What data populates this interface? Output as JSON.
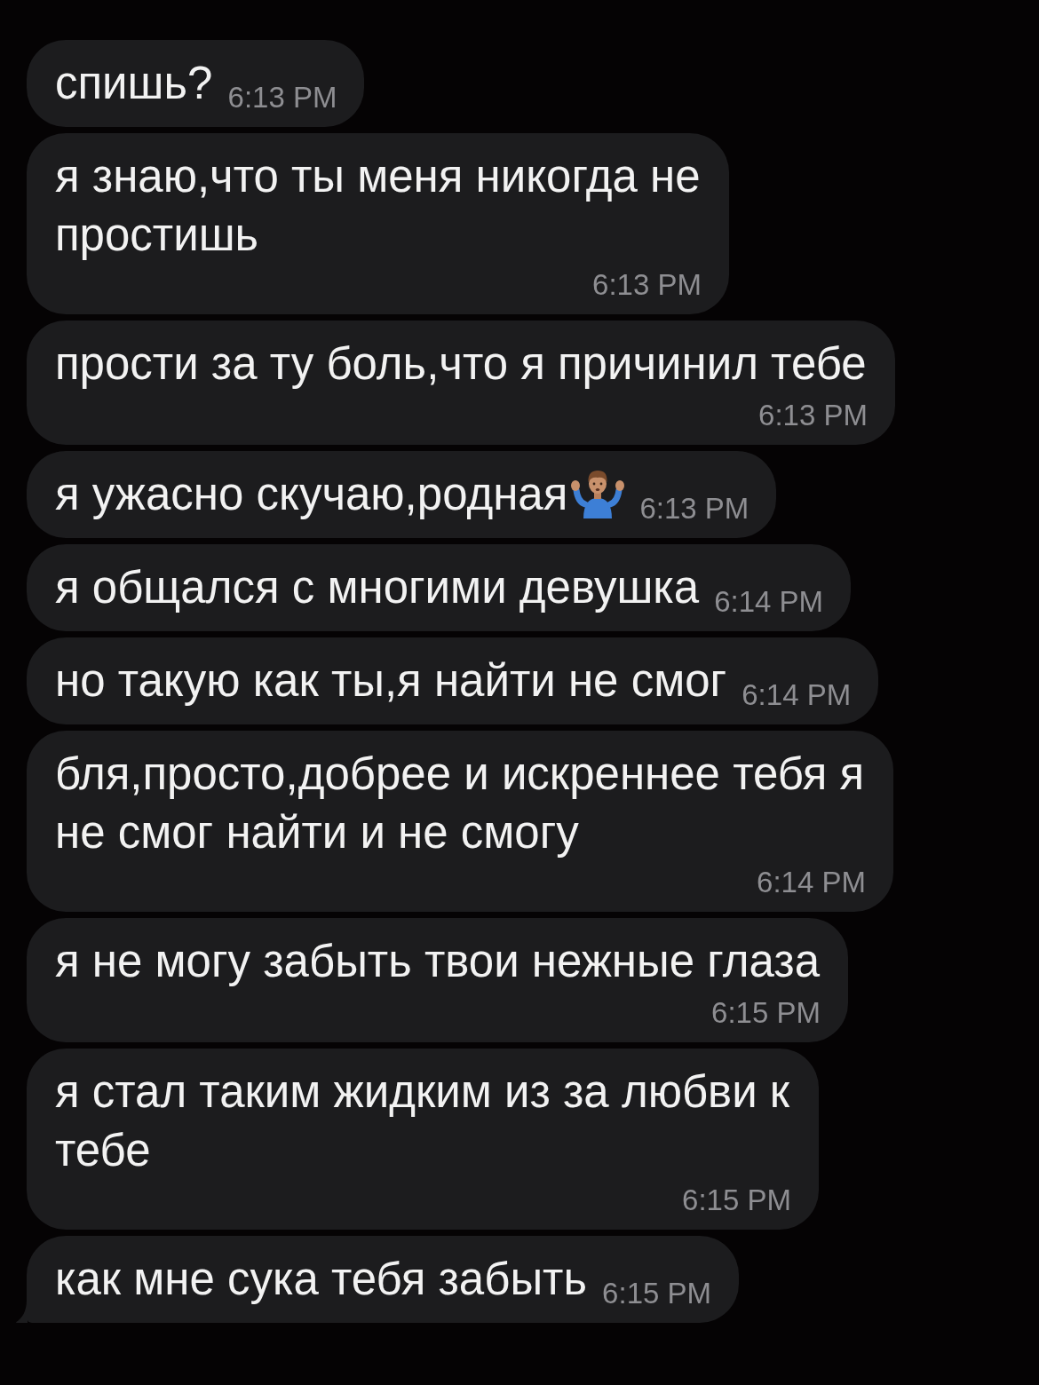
{
  "messages": [
    {
      "text": "спишь?",
      "time": "6:13 PM",
      "emoji": false,
      "tail": false
    },
    {
      "text": "я знаю,что ты меня никогда не простишь",
      "time": "6:13 PM",
      "emoji": false,
      "tail": false
    },
    {
      "text": "прости за ту боль,что я причинил тебе",
      "time": "6:13 PM",
      "emoji": false,
      "tail": false
    },
    {
      "text": "я ужасно скучаю,родная",
      "time": "6:13 PM",
      "emoji": true,
      "tail": false
    },
    {
      "text": "я общался с многими девушка",
      "time": "6:14 PM",
      "emoji": false,
      "tail": false
    },
    {
      "text": "но такую как ты,я найти не смог",
      "time": "6:14 PM",
      "emoji": false,
      "tail": false
    },
    {
      "text": "бля,просто,добрее и искреннее тебя я не смог найти и не смогу",
      "time": "6:14 PM",
      "emoji": false,
      "tail": false
    },
    {
      "text": "я не могу забыть твои нежные глаза",
      "time": "6:15 PM",
      "emoji": false,
      "tail": false
    },
    {
      "text": "я стал таким жидким из за любви к тебе",
      "time": "6:15 PM",
      "emoji": false,
      "tail": false
    },
    {
      "text": "как мне сука тебя забыть",
      "time": "6:15 PM",
      "emoji": false,
      "tail": true
    }
  ]
}
